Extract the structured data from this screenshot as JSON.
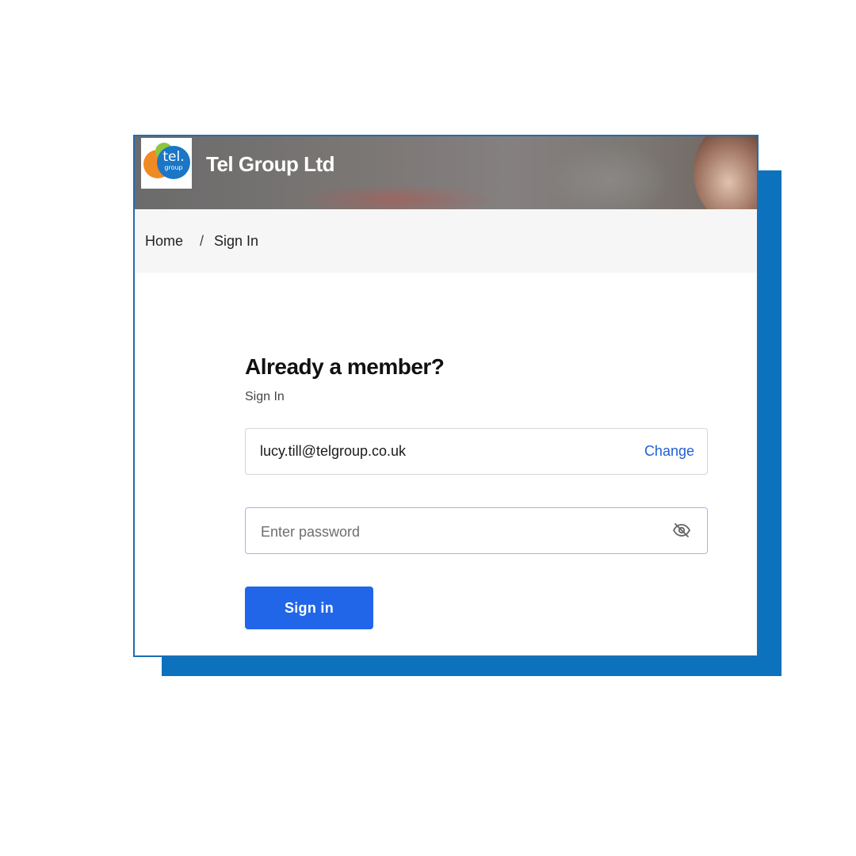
{
  "brand": {
    "logo_text": "tel.",
    "logo_subtext": "group",
    "title": "Tel Group Ltd"
  },
  "breadcrumb": {
    "home": "Home",
    "separator": "/",
    "current": "Sign In"
  },
  "form": {
    "heading": "Already a member?",
    "subheading": "Sign In",
    "email_value": "lucy.till@telgroup.co.uk",
    "change_label": "Change",
    "password_placeholder": "Enter password",
    "password_value": "",
    "password_toggle_icon": "eye-slash-icon",
    "submit_label": "Sign in"
  },
  "colors": {
    "accent_blue": "#0d72bd",
    "button_blue": "#2166e8",
    "link_blue": "#1f5fd6",
    "logo_orange": "#f08a24",
    "logo_green": "#8dc63f",
    "logo_blue": "#1b76c5"
  }
}
